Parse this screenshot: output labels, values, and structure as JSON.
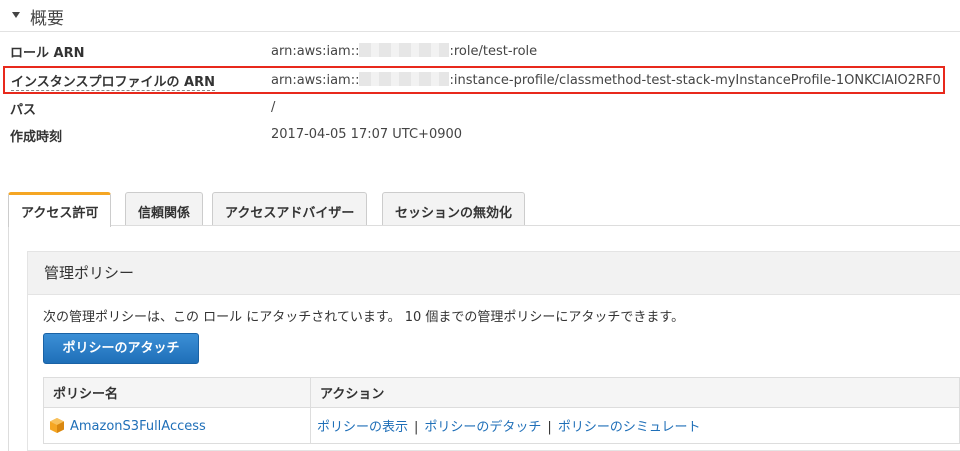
{
  "section": {
    "title": "概要"
  },
  "summary": {
    "role_arn": {
      "label": "ロール ARN",
      "prefix": "arn:aws:iam::",
      "suffix": ":role/test-role"
    },
    "instance_profile_arn": {
      "label": "インスタンスプロファイルの ARN",
      "prefix": "arn:aws:iam::",
      "suffix": ":instance-profile/classmethod-test-stack-myInstanceProfile-1ONKCIAIO2RF0"
    },
    "path": {
      "label": "パス",
      "value": "/"
    },
    "created": {
      "label": "作成時刻",
      "value": "2017-04-05 17:07 UTC+0900"
    }
  },
  "tabs": [
    {
      "label": "アクセス許可",
      "active": true
    },
    {
      "label": "信頼関係",
      "active": false
    },
    {
      "label": "アクセスアドバイザー",
      "active": false
    },
    {
      "label": "セッションの無効化",
      "active": false
    }
  ],
  "managed_policies": {
    "title": "管理ポリシー",
    "description": "次の管理ポリシーは、この ロール にアタッチされています。 10 個までの管理ポリシーにアタッチできます。",
    "attach_button": "ポリシーのアタッチ",
    "columns": [
      "ポリシー名",
      "アクション"
    ],
    "rows": [
      {
        "name": "AmazonS3FullAccess",
        "actions": [
          "ポリシーの表示",
          "ポリシーのデタッチ",
          "ポリシーのシミュレート"
        ]
      }
    ],
    "separator": "|"
  },
  "colors": {
    "highlight": "#e8291c",
    "active_tab": "#f5a623",
    "link": "#1f6fb8",
    "button": "#1f6fb8",
    "policy_icon": "#f5a623"
  }
}
